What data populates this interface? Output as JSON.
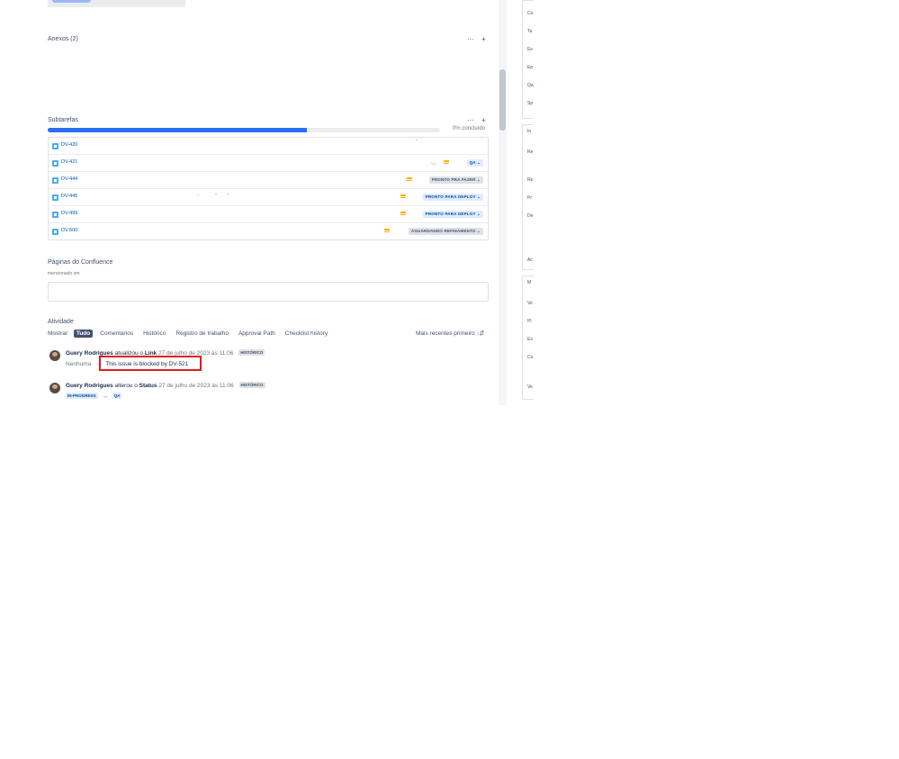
{
  "attachments": {
    "title": "Anexos (2)",
    "more": "···",
    "add": "+"
  },
  "subtasks": {
    "title": "Subtarefas",
    "more": "···",
    "add": "+",
    "progress_label": "0% concluído",
    "progress_fraction": 0.66,
    "rows": [
      {
        "key": "DV-420",
        "status": ""
      },
      {
        "key": "DV-421",
        "status": "QA ⌄"
      },
      {
        "key": "DV-444",
        "status": "PRONTO PRA FAZER ⌄"
      },
      {
        "key": "DV-445",
        "status": "PRONTO PARA DEPLOY ⌄"
      },
      {
        "key": "DV-499",
        "status": "PRONTO PARA DEPLOY ⌄"
      },
      {
        "key": "DV-500",
        "status": "AGUARDANDO REFINAMENTO ⌄"
      }
    ]
  },
  "confluence": {
    "title": "Páginas do Confluence",
    "subtitle": "mencionado em"
  },
  "activity": {
    "title": "Atividade",
    "show_label": "Mostrar:",
    "tabs": [
      "Tudo",
      "Comentários",
      "Histórico",
      "Registro de trabalho",
      "Approval Path",
      "Checklist history"
    ],
    "sort_label": "Mais recentes primeiro ↓⇵",
    "entries": [
      {
        "user": "Guery Rodrigues",
        "action": "atualizou o",
        "field": "Link",
        "date": "27 de julho de 2023 às 11:06",
        "badge": "HISTÓRICO",
        "from": "Nenhuma",
        "arrow": "→",
        "to": "This issue is blocked by DV-521"
      },
      {
        "user": "Guery Rodrigues",
        "action": "alterou o",
        "field": "Status",
        "date": "27 de julho de 2023 às 11:06",
        "badge": "HISTÓRICO",
        "from": "IN-PROGRESS",
        "arrow": "→",
        "to": "QA"
      }
    ]
  },
  "right_panel": {
    "labels": [
      "Co",
      "Ta",
      "Es",
      "Ep",
      "Qa",
      "Sp",
      "In",
      "Re",
      "Re",
      "Pr",
      "De",
      "Ac",
      "M",
      "Ve",
      "Pl",
      "Es",
      "Co",
      "Ve"
    ]
  },
  "colors": {
    "accent": "#2b6ef5",
    "highlight": "#e31b1b",
    "priority": "#ffab00"
  },
  "icons": {
    "subtask": "subtask-icon",
    "priority": "priority-medium-icon",
    "watch": "eye-icon"
  }
}
